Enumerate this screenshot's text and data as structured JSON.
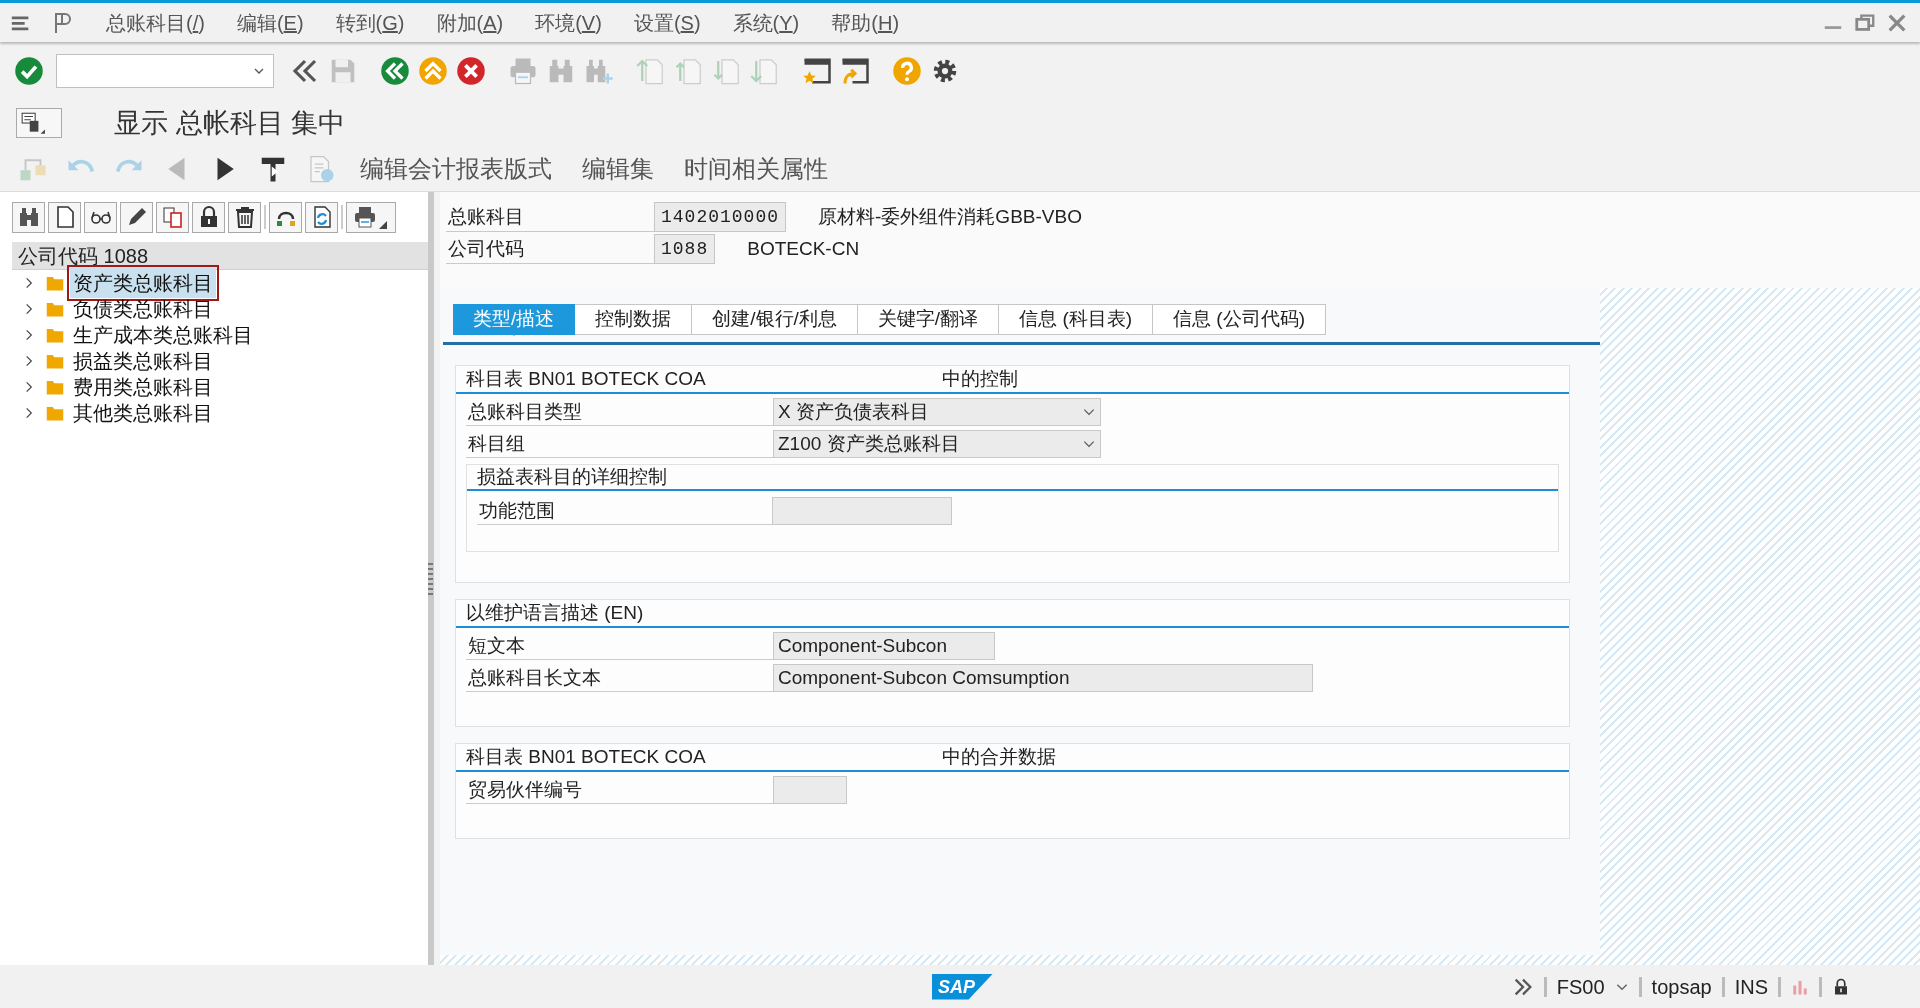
{
  "menu": [
    {
      "text": "总账科目(",
      "key": "/",
      "tail": ")"
    },
    {
      "text": "编辑(",
      "key": "E",
      "tail": ")"
    },
    {
      "text": "转到(",
      "key": "G",
      "tail": ")"
    },
    {
      "text": "附加(",
      "key": "A",
      "tail": ")"
    },
    {
      "text": "环境(",
      "key": "V",
      "tail": ")"
    },
    {
      "text": "设置(",
      "key": "S",
      "tail": ")"
    },
    {
      "text": "系统(",
      "key": "Y",
      "tail": ")"
    },
    {
      "text": "帮助(",
      "key": "H",
      "tail": ")"
    }
  ],
  "system_toolbar": [
    {
      "kind": "enter",
      "disabled": false
    },
    {
      "kind": "command-field"
    },
    {
      "kind": "toggle",
      "disabled": false
    },
    {
      "kind": "save",
      "disabled": true
    },
    {
      "kind": "back",
      "disabled": false
    },
    {
      "kind": "exit",
      "disabled": false
    },
    {
      "kind": "cancel",
      "disabled": false
    },
    {
      "kind": "print",
      "disabled": true
    },
    {
      "kind": "find",
      "disabled": true
    },
    {
      "kind": "find-next",
      "disabled": true
    },
    {
      "kind": "first-page",
      "disabled": true
    },
    {
      "kind": "prev-page",
      "disabled": true
    },
    {
      "kind": "next-page",
      "disabled": true
    },
    {
      "kind": "last-page",
      "disabled": true
    },
    {
      "kind": "new-session",
      "disabled": false
    },
    {
      "kind": "shortcut",
      "disabled": false
    },
    {
      "kind": "help",
      "disabled": false
    },
    {
      "kind": "settings",
      "disabled": false
    }
  ],
  "window": {
    "title": "显示 总帐科目 集中"
  },
  "app_toolbar": {
    "icons": [
      {
        "kind": "hierarchy",
        "disabled": true
      },
      {
        "kind": "undo",
        "disabled": true
      },
      {
        "kind": "redo",
        "disabled": true
      },
      {
        "kind": "previous",
        "disabled": true
      },
      {
        "kind": "next",
        "disabled": false
      },
      {
        "kind": "template",
        "disabled": false
      },
      {
        "kind": "document",
        "disabled": true
      }
    ],
    "functions": [
      "编辑会计报表版式",
      "编辑集",
      "时间相关属性"
    ]
  },
  "tree": {
    "toolbar": [
      {
        "kind": "find"
      },
      {
        "kind": "create"
      },
      {
        "kind": "display"
      },
      {
        "kind": "change"
      },
      {
        "kind": "copy"
      },
      {
        "kind": "lock"
      },
      {
        "kind": "delete"
      },
      {
        "kind": "separator"
      },
      {
        "kind": "transport"
      },
      {
        "kind": "refresh"
      },
      {
        "kind": "separator"
      },
      {
        "kind": "print"
      }
    ],
    "header": "公司代码 1088",
    "items": [
      {
        "label": "资产类总账科目",
        "selected": true,
        "expanded": false
      },
      {
        "label": "负债类总账科目",
        "selected": false,
        "expanded": false
      },
      {
        "label": "生产成本类总账科目",
        "selected": false,
        "expanded": false
      },
      {
        "label": "损益类总账科目",
        "selected": false,
        "expanded": false
      },
      {
        "label": "费用类总账科目",
        "selected": false,
        "expanded": false
      },
      {
        "label": "其他类总账科目",
        "selected": false,
        "expanded": false
      }
    ]
  },
  "header_fields": [
    {
      "label": "总账科目",
      "value": "1402010000",
      "description": "原材料-委外组件消耗GBB-VBO"
    },
    {
      "label": "公司代码",
      "value": "1088",
      "description": "BOTECK-CN"
    }
  ],
  "tabs": [
    {
      "label": "类型/描述",
      "selected": true
    },
    {
      "label": "控制数据",
      "selected": false
    },
    {
      "label": "创建/银行/利息",
      "selected": false
    },
    {
      "label": "关键字/翻译",
      "selected": false
    },
    {
      "label": "信息 (科目表)",
      "selected": false
    },
    {
      "label": "信息 (公司代码)",
      "selected": false
    }
  ],
  "groups": [
    {
      "title": "科目表 BN01 BOTECK COA",
      "title_suffix": "中的控制",
      "rows": [
        {
          "label": "总账科目类型",
          "kind": "dropdown",
          "value": "X 资产负债表科目"
        },
        {
          "label": "科目组",
          "kind": "dropdown",
          "value": "Z100 资产类总账科目"
        }
      ],
      "subgroups": [
        {
          "title": "损益表科目的详细控制",
          "rows": [
            {
              "label": "功能范围",
              "kind": "input"
            }
          ]
        }
      ]
    },
    {
      "title": "以维护语言描述 (EN)",
      "rows": [
        {
          "label": "短文本",
          "kind": "input",
          "value": "Component-Subcon"
        },
        {
          "label": "总账科目长文本",
          "kind": "input",
          "value": "Component-Subcon Comsumption"
        }
      ]
    },
    {
      "title": "科目表 BN01 BOTECK COA",
      "title_suffix": "中的合并数据",
      "rows": [
        {
          "label": "贸易伙伴编号",
          "kind": "input"
        }
      ]
    }
  ],
  "status_bar": {
    "logo": "SAP",
    "transaction": "FS00",
    "system": "topsap",
    "mode": "INS"
  }
}
